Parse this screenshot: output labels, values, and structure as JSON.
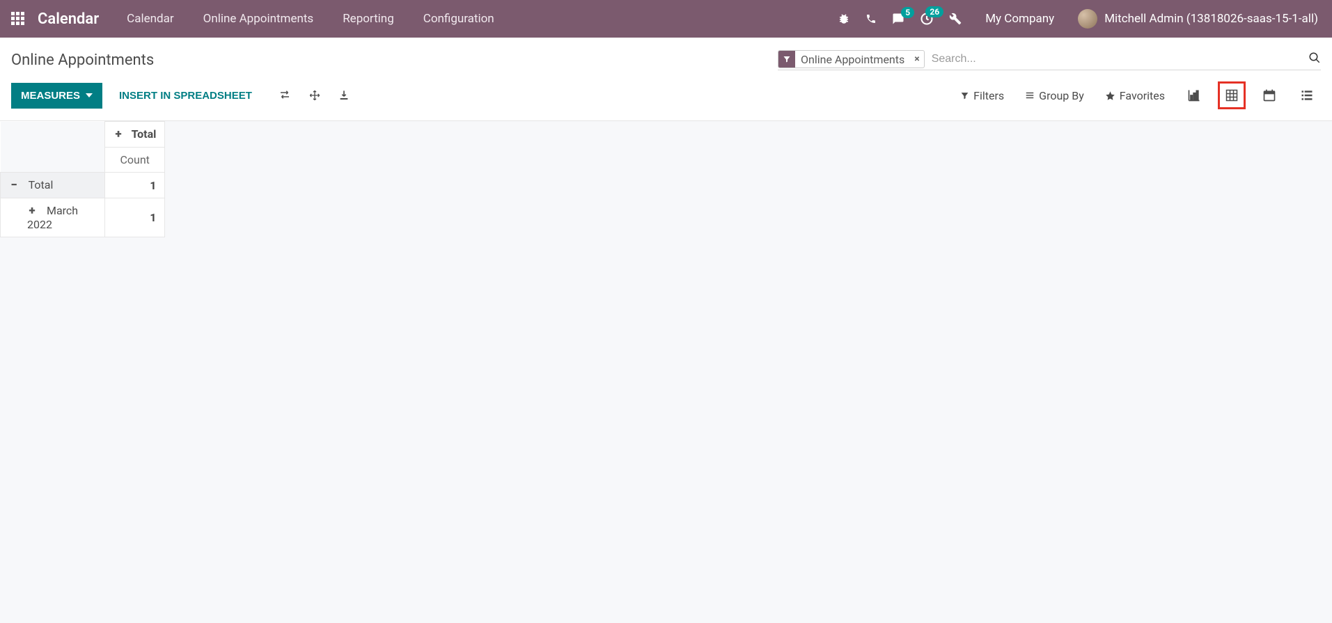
{
  "nav": {
    "brand": "Calendar",
    "items": [
      "Calendar",
      "Online Appointments",
      "Reporting",
      "Configuration"
    ],
    "company": "My Company",
    "user": "Mitchell Admin (13818026-saas-15-1-all)",
    "messages_badge": "5",
    "activities_badge": "26"
  },
  "breadcrumb": "Online Appointments",
  "search": {
    "facet_label": "Online Appointments",
    "placeholder": "Search..."
  },
  "buttons": {
    "measures": "MEASURES",
    "insert_spreadsheet": "INSERT IN SPREADSHEET"
  },
  "search_options": {
    "filters": "Filters",
    "group_by": "Group By",
    "favorites": "Favorites"
  },
  "pivot": {
    "col_header": "Total",
    "measure": "Count",
    "rows": [
      {
        "label": "Total",
        "value": "1",
        "expanded": true,
        "indent": false
      },
      {
        "label": "March 2022",
        "value": "1",
        "expanded": false,
        "indent": true
      }
    ]
  }
}
